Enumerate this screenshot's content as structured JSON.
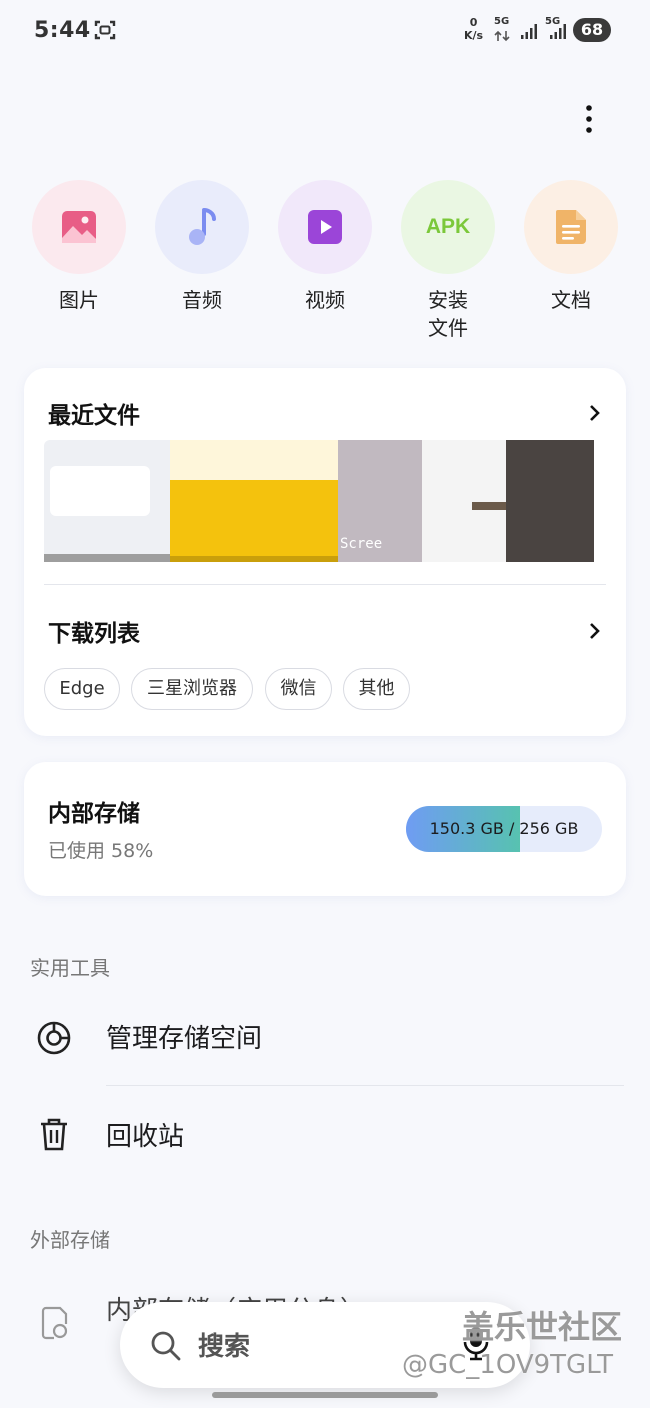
{
  "status_bar": {
    "time": "5:44",
    "net_speed_value": "0",
    "net_speed_unit": "K/s",
    "sim1_label": "5G",
    "sim2_label": "5G",
    "battery": "68"
  },
  "categories": [
    {
      "label": "图片",
      "icon": "image-icon",
      "bg": "#fbe9ee",
      "color": "#e85d86"
    },
    {
      "label": "音频",
      "icon": "music-note-icon",
      "bg": "#e9ecfb",
      "color": "#7b8cf0"
    },
    {
      "label": "视频",
      "icon": "video-play-icon",
      "bg": "#f1e8fa",
      "color": "#9b45d8"
    },
    {
      "label": "安装文件",
      "icon": "apk-icon",
      "icon_text": "APK",
      "bg": "#eaf7e3",
      "color": "#7bc83a"
    },
    {
      "label": "文档",
      "icon": "document-icon",
      "bg": "#fcefe4",
      "color": "#f0b468"
    }
  ],
  "recent_files": {
    "title": "最近文件",
    "thumb_text": "Scree"
  },
  "downloads": {
    "title": "下载列表",
    "chips": [
      "Edge",
      "三星浏览器",
      "微信",
      "其他"
    ]
  },
  "internal_storage": {
    "title": "内部存储",
    "usage_label": "已使用 58%",
    "used_fraction": 0.58,
    "used": "150.3 GB",
    "total": "/ 256 GB",
    "gradient_start": "#6f9cf3",
    "gradient_end": "#57c2b0"
  },
  "tools": {
    "section_title": "实用工具",
    "items": [
      {
        "label": "管理存储空间",
        "icon": "storage-pie-icon"
      },
      {
        "label": "回收站",
        "icon": "trash-icon"
      }
    ]
  },
  "external_storage": {
    "section_title": "外部存储",
    "item_label": "内部存储（应用分身）",
    "item_icon": "clone-storage-icon"
  },
  "search": {
    "label": "搜索"
  },
  "watermark": {
    "line1": "盖乐世社区",
    "line2": "@GC_1OV9TGLT"
  }
}
